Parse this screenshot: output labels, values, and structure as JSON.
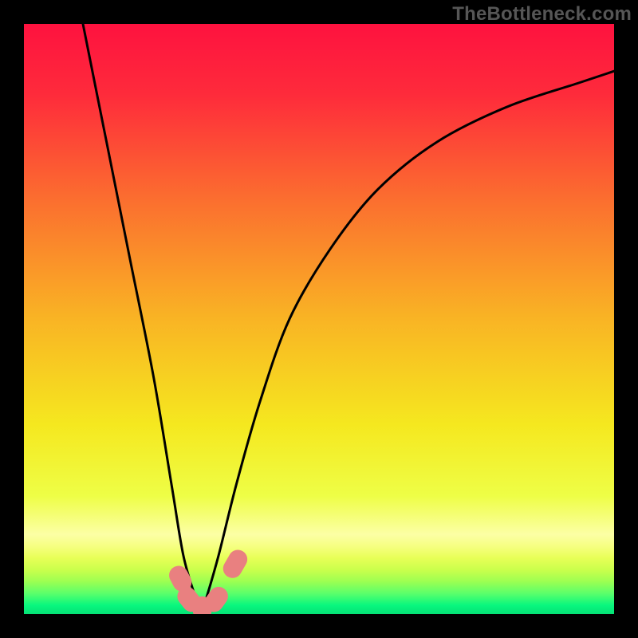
{
  "watermark": "TheBottleneck.com",
  "chart_data": {
    "type": "line",
    "title": "",
    "xlabel": "",
    "ylabel": "",
    "xlim": [
      0,
      100
    ],
    "ylim": [
      0,
      100
    ],
    "grid": false,
    "legend": false,
    "series": [
      {
        "name": "bottleneck-curve",
        "x": [
          10,
          14,
          18,
          22,
          25,
          27,
          29,
          30,
          31,
          33,
          36,
          40,
          45,
          52,
          60,
          70,
          82,
          94,
          100
        ],
        "y": [
          100,
          80,
          60,
          40,
          22,
          10,
          3,
          0,
          3,
          10,
          22,
          36,
          50,
          62,
          72,
          80,
          86,
          90,
          92
        ]
      }
    ],
    "markers": [
      {
        "name": "pink-marker",
        "x": 26.5,
        "y": 6,
        "w": 3.2,
        "h": 4.5,
        "rot": -28
      },
      {
        "name": "pink-marker",
        "x": 28.0,
        "y": 2.5,
        "w": 3.2,
        "h": 4.5,
        "rot": -38
      },
      {
        "name": "pink-marker",
        "x": 30.2,
        "y": 1.0,
        "w": 3.2,
        "h": 4.0,
        "rot": 0
      },
      {
        "name": "pink-marker",
        "x": 32.6,
        "y": 2.5,
        "w": 3.2,
        "h": 4.5,
        "rot": 36
      },
      {
        "name": "pink-marker",
        "x": 35.8,
        "y": 8.5,
        "w": 3.2,
        "h": 5.0,
        "rot": 30
      }
    ],
    "gradient_bands": [
      {
        "stop": 0.0,
        "color": "#fe123f"
      },
      {
        "stop": 0.12,
        "color": "#fe2b3b"
      },
      {
        "stop": 0.3,
        "color": "#fb6f2f"
      },
      {
        "stop": 0.5,
        "color": "#f9b424"
      },
      {
        "stop": 0.68,
        "color": "#f5e81f"
      },
      {
        "stop": 0.8,
        "color": "#eefe46"
      },
      {
        "stop": 0.865,
        "color": "#fcffa5"
      },
      {
        "stop": 0.885,
        "color": "#f6ff81"
      },
      {
        "stop": 0.905,
        "color": "#e8ff57"
      },
      {
        "stop": 0.925,
        "color": "#caff4c"
      },
      {
        "stop": 0.945,
        "color": "#9cff52"
      },
      {
        "stop": 0.965,
        "color": "#5bff6b"
      },
      {
        "stop": 0.985,
        "color": "#09f77e"
      },
      {
        "stop": 1.0,
        "color": "#05e276"
      }
    ],
    "marker_color": "#e98080",
    "curve_color": "#000000"
  }
}
